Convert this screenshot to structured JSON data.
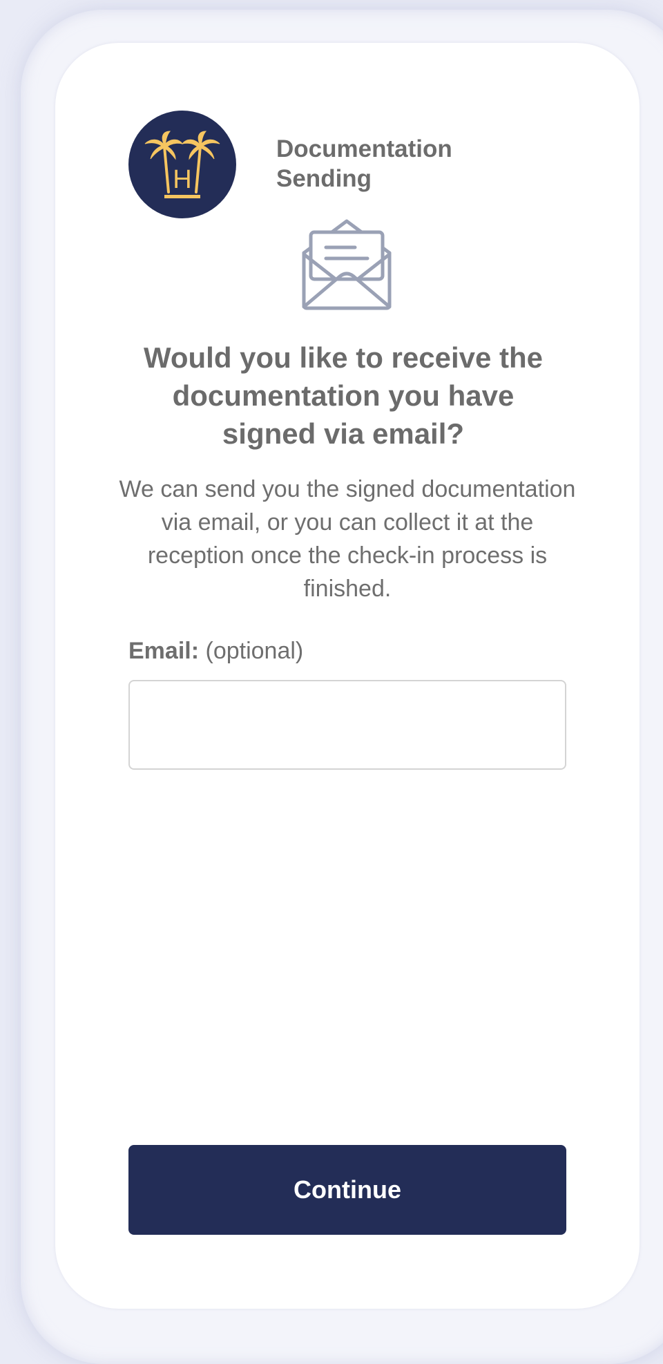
{
  "header": {
    "title": "Documentation Sending",
    "logo_icon": "hotel-palm-trees-logo",
    "logo_letter": "H"
  },
  "main": {
    "envelope_icon": "open-envelope-icon",
    "question": "Would you like to receive the documentation you have signed via email?",
    "description": "We can send you the signed documentation via email, or you can collect it at the reception once the check-in process is finished.",
    "email_label": "Email:",
    "email_optional": "(optional)",
    "email_value": "",
    "email_placeholder": ""
  },
  "footer": {
    "continue_label": "Continue"
  },
  "colors": {
    "brand_navy": "#232d57",
    "logo_gold": "#f6c560",
    "text_gray": "#6c6c6c",
    "icon_gray": "#9aa1b5",
    "background": "#e9ebf6"
  }
}
